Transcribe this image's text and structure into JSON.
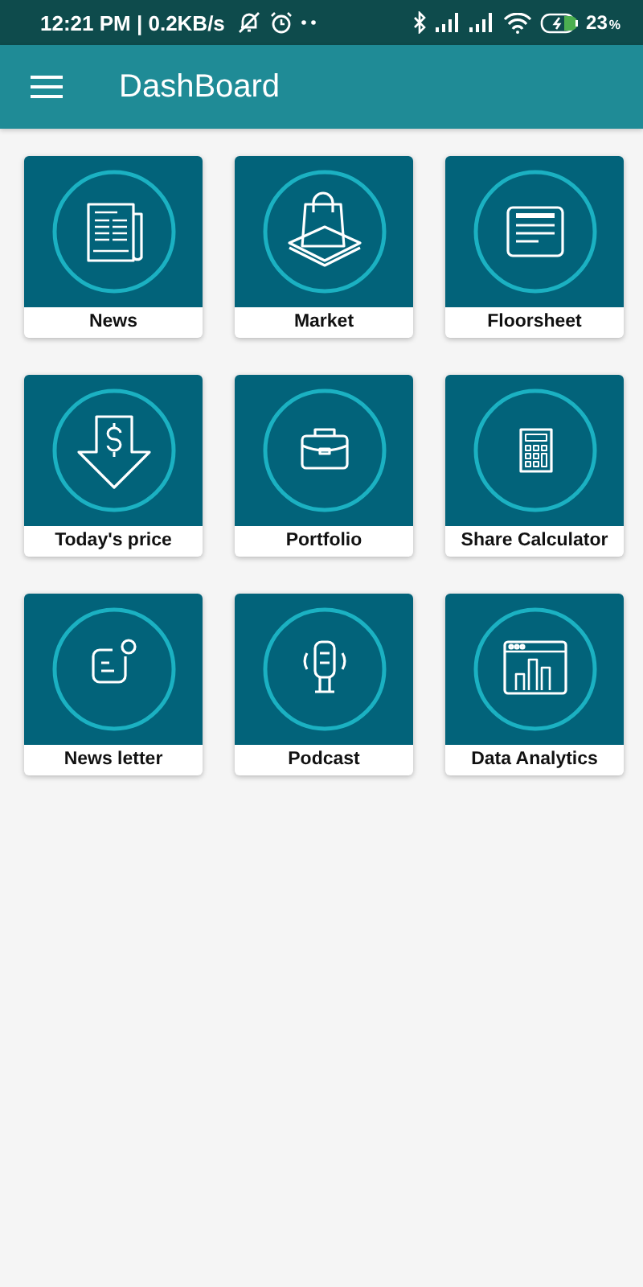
{
  "status_bar": {
    "time": "12:21 PM | 0.2KB/s",
    "battery": "23",
    "battery_unit": "%"
  },
  "app_bar": {
    "title": "DashBoard"
  },
  "tiles": [
    {
      "label": "News",
      "kind": "newspaper"
    },
    {
      "label": "Market",
      "kind": "shopping"
    },
    {
      "label": "Floorsheet",
      "kind": "document"
    },
    {
      "label": "Today's price",
      "kind": "price"
    },
    {
      "label": "Portfolio",
      "kind": "briefcase"
    },
    {
      "label": "Share Calculator",
      "kind": "calculator"
    },
    {
      "label": "News letter",
      "kind": "message"
    },
    {
      "label": "Podcast",
      "kind": "microphone"
    },
    {
      "label": "Data Analytics",
      "kind": "analytics"
    }
  ]
}
